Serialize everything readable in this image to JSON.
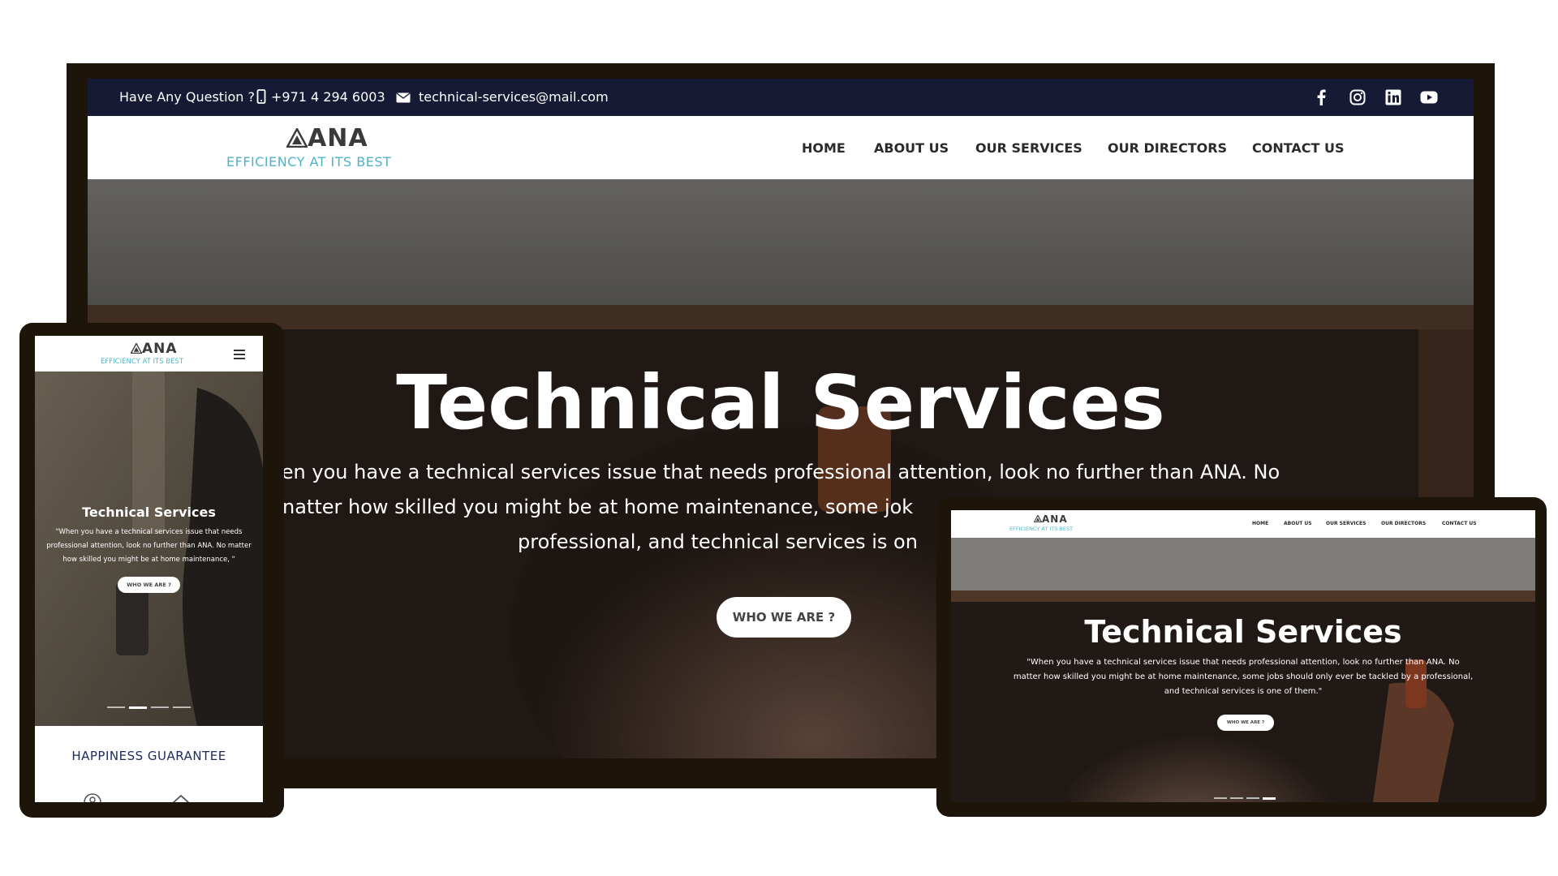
{
  "site": {
    "logo_text": "ANA",
    "logo_tagline": "EFFICIENCY AT ITS BEST"
  },
  "topbar": {
    "question_label": "Have Any Question ?",
    "phone": "+971 4 294 6003",
    "email": "technical-services@mail.com",
    "social_icons": [
      "facebook-icon",
      "instagram-icon",
      "linkedin-icon",
      "youtube-icon"
    ]
  },
  "nav": {
    "items": [
      "HOME",
      "ABOUT US",
      "OUR SERVICES",
      "OUR DIRECTORS",
      "CONTACT US"
    ]
  },
  "hero": {
    "title": "Technical Services",
    "desktop_text_line1": "en you have a technical services issue that needs professional attention, look no further than ANA. No",
    "desktop_text_line2": "natter how skilled you might be at home maintenance, some jok",
    "desktop_text_line2b": "professional, and technical services is on",
    "laptop_text": "\"When you have a technical services issue that needs professional attention, look no further than ANA. No matter how skilled you might be at home maintenance, some jobs should only ever be tackled by a professional, and technical services is one of them.\"",
    "tablet_text": "\"When you have a technical services issue that needs professional attention, look no further than ANA. No matter how skilled you might be at home maintenance, \"",
    "button_label": "WHO WE ARE ?"
  },
  "tablet": {
    "section_title": "HAPPINESS GUARANTEE"
  },
  "colors": {
    "topbar_bg": "#161a35",
    "tagline": "#4fb3c8",
    "device_frame": "#1d140a",
    "section_title": "#1d2a5a"
  }
}
